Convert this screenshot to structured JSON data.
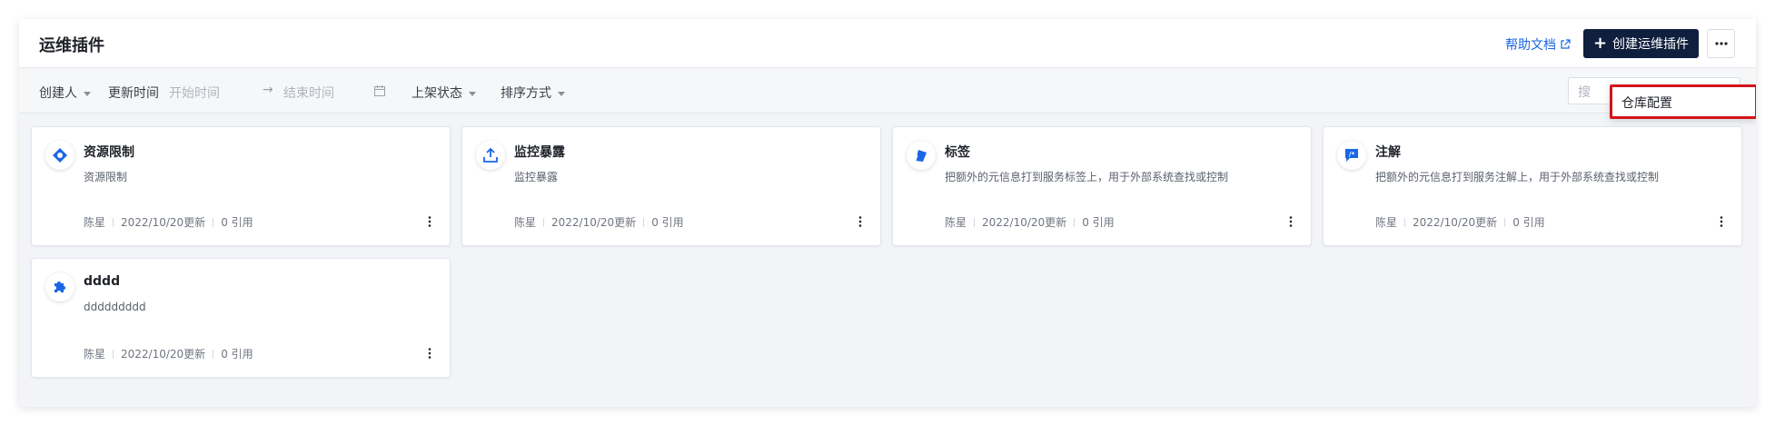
{
  "header": {
    "title": "运维插件",
    "help_link": "帮助文档",
    "create_button": "创建运维插件"
  },
  "filters": {
    "creator": "创建人",
    "update_time": "更新时间",
    "start_placeholder": "开始时间",
    "end_placeholder": "结束时间",
    "shelf_status": "上架状态",
    "sort": "排序方式",
    "search_placeholder": "搜"
  },
  "dropdown": {
    "item": "仓库配置"
  },
  "cards": [
    {
      "title": "资源限制",
      "desc": "资源限制",
      "author": "陈星",
      "updated": "2022/10/20更新",
      "refs": "0 引用",
      "icon": "diamond-icon"
    },
    {
      "title": "监控暴露",
      "desc": "监控暴露",
      "author": "陈星",
      "updated": "2022/10/20更新",
      "refs": "0 引用",
      "icon": "upload-icon"
    },
    {
      "title": "标签",
      "desc": "把额外的元信息打到服务标签上，用于外部系统查找或控制",
      "author": "陈星",
      "updated": "2022/10/20更新",
      "refs": "0 引用",
      "icon": "tag-icon"
    },
    {
      "title": "注解",
      "desc": "把额外的元信息打到服务注解上，用于外部系统查找或控制",
      "author": "陈星",
      "updated": "2022/10/20更新",
      "refs": "0 引用",
      "icon": "comment-icon"
    },
    {
      "title": "dddd",
      "desc": "ddddddddd",
      "author": "陈星",
      "updated": "2022/10/20更新",
      "refs": "0 引用",
      "icon": "puzzle-icon"
    }
  ],
  "colors": {
    "primary_button": "#0f1f3d",
    "link": "#1a66e5",
    "icon_blue": "#1a66e5",
    "highlight_border": "#d4141a"
  }
}
